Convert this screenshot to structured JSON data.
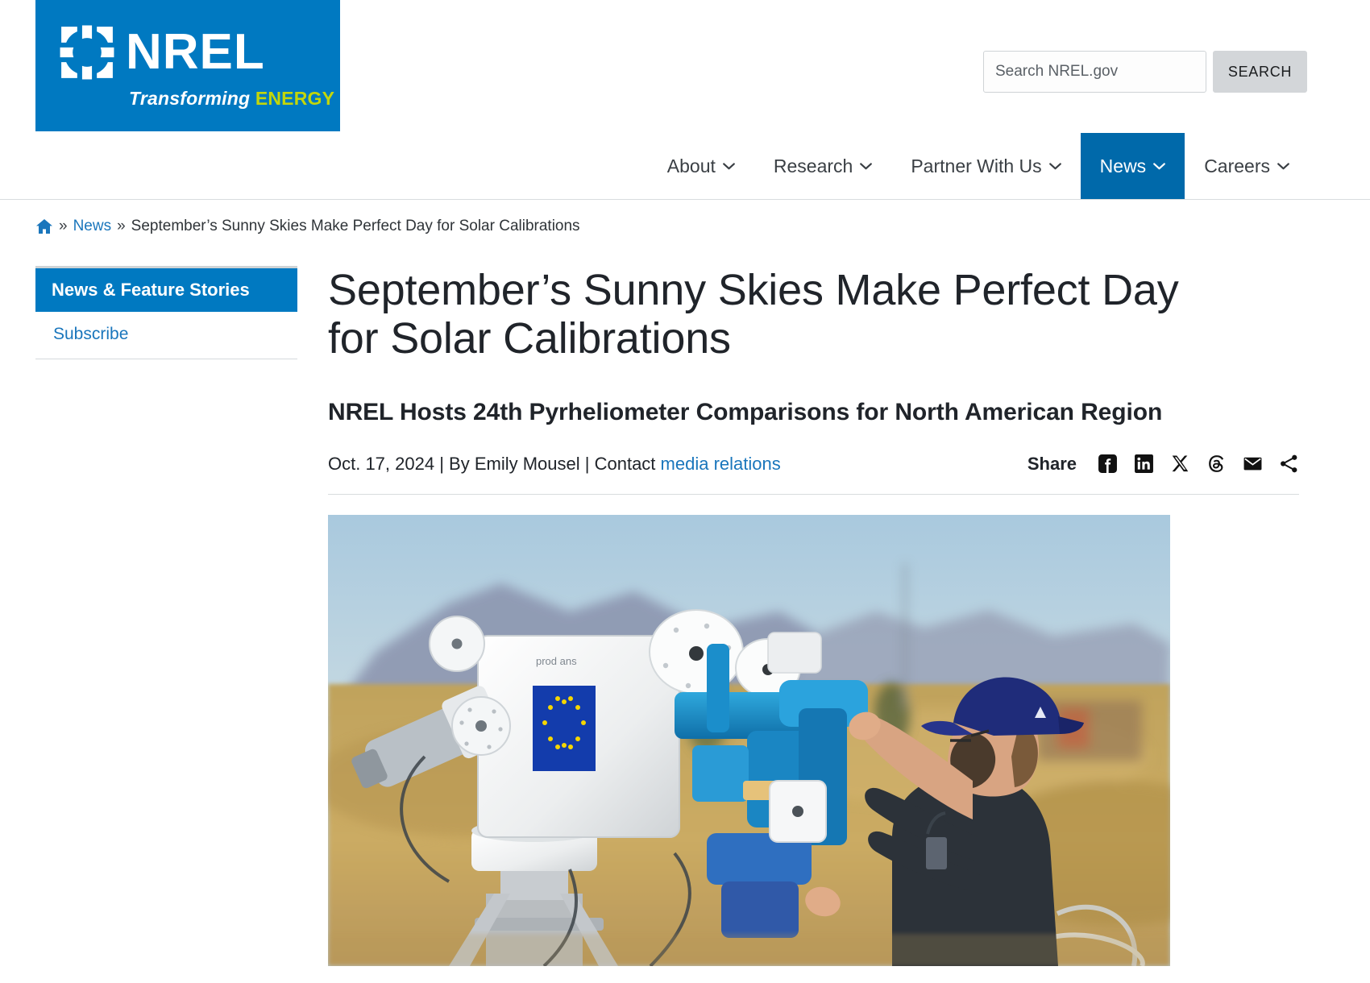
{
  "brand": {
    "logo_word": "NREL",
    "tagline_1": "Transforming ",
    "tagline_2": "ENERGY",
    "blue": "#0079c1",
    "green": "#c3d60a",
    "link_blue": "#1a76bc",
    "nav_active_blue": "#0069aa"
  },
  "search": {
    "placeholder": "Search NREL.gov",
    "value": "",
    "button_label": "SEARCH",
    "icon": "search-icon"
  },
  "nav": {
    "items": [
      {
        "label": "About",
        "active": false,
        "icon": "chevron-down-icon"
      },
      {
        "label": "Research",
        "active": false,
        "icon": "chevron-down-icon"
      },
      {
        "label": "Partner With Us",
        "active": false,
        "icon": "chevron-down-icon"
      },
      {
        "label": "News",
        "active": true,
        "icon": "chevron-down-icon"
      },
      {
        "label": "Careers",
        "active": false,
        "icon": "chevron-down-icon"
      }
    ]
  },
  "breadcrumb": {
    "home_icon": "home-icon",
    "separator": "»",
    "link": "News",
    "current": "September’s Sunny Skies Make Perfect Day for Solar Calibrations"
  },
  "sidebar": {
    "active_item": "News & Feature Stories",
    "items": [
      {
        "label": "Subscribe"
      }
    ]
  },
  "article": {
    "headline": "September’s Sunny Skies Make Perfect Day for Solar Calibrations",
    "subhead": "NREL Hosts 24th Pyrheliometer Comparisons for North American Region",
    "date": "Oct. 17, 2024",
    "separator_1": " | ",
    "byline_author": "By Emily Mousel",
    "separator_2": " | ",
    "contact_prefix": "Contact ",
    "contact_link": "media relations"
  },
  "share": {
    "label": "Share",
    "icons": [
      {
        "name": "facebook-icon",
        "title": "Facebook"
      },
      {
        "name": "linkedin-icon",
        "title": "LinkedIn"
      },
      {
        "name": "x-twitter-icon",
        "title": "X"
      },
      {
        "name": "threads-icon",
        "title": "Threads"
      },
      {
        "name": "email-icon",
        "title": "Email"
      },
      {
        "name": "share-network-icon",
        "title": "Share"
      }
    ]
  },
  "hero_photo": {
    "alt": "Researcher in a blue cap adjusting a white and blue solar tracking pyrheliometer instrument in a dry golden field with blurred mountains under a clear blue sky",
    "sky_color": "#b5d2e2",
    "field_color": "#c9a961",
    "instrument_color": "#f2f2f0",
    "accent_blue": "#1787c8",
    "cap_color": "#1f2c7a"
  }
}
